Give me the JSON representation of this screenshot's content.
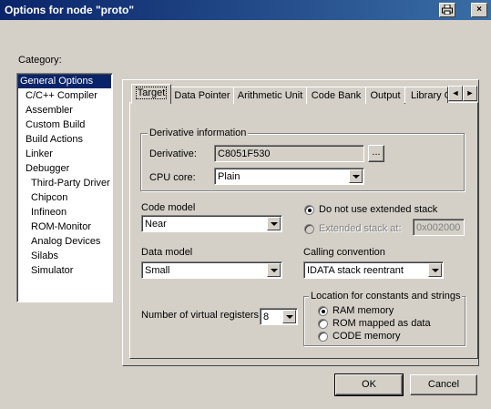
{
  "window": {
    "title": "Options for node \"proto\"",
    "print_icon": "printer-icon",
    "close_label": "×"
  },
  "category": {
    "label": "Category:",
    "items": [
      {
        "label": "General Options"
      },
      {
        "label": "C/C++ Compiler"
      },
      {
        "label": "Assembler"
      },
      {
        "label": "Custom Build"
      },
      {
        "label": "Build Actions"
      },
      {
        "label": "Linker"
      },
      {
        "label": "Debugger"
      },
      {
        "label": "Third-Party Driver"
      },
      {
        "label": "Chipcon"
      },
      {
        "label": "Infineon"
      },
      {
        "label": "ROM-Monitor"
      },
      {
        "label": "Analog Devices"
      },
      {
        "label": "Silabs"
      },
      {
        "label": "Simulator"
      }
    ],
    "selected": "General Options"
  },
  "tabs": [
    {
      "label": "Target"
    },
    {
      "label": "Data Pointer"
    },
    {
      "label": "Arithmetic Unit"
    },
    {
      "label": "Code Bank"
    },
    {
      "label": "Output"
    },
    {
      "label": "Library C"
    }
  ],
  "tab_scroll": {
    "left": "◄",
    "right": "►"
  },
  "derivative": {
    "group_label": "Derivative information",
    "derivative_label": "Derivative:",
    "derivative_value": "C8051F530",
    "browse_label": "...",
    "cpu_core_label": "CPU core:",
    "cpu_core_value": "Plain"
  },
  "code_model": {
    "label": "Code model",
    "value": "Near"
  },
  "data_model": {
    "label": "Data model",
    "value": "Small"
  },
  "stack": {
    "no_extended_label": "Do not use extended stack",
    "extended_label": "Extended stack at:",
    "extended_value": "0x002000",
    "selected": "no_extended"
  },
  "calling_convention": {
    "label": "Calling convention",
    "value": "IDATA stack reentrant"
  },
  "virtual_registers": {
    "label": "Number of virtual registers:",
    "value": "8"
  },
  "location": {
    "group_label": "Location for constants and strings",
    "options": [
      {
        "label": "RAM memory",
        "selected": true
      },
      {
        "label": "ROM mapped as data",
        "selected": false
      },
      {
        "label": "CODE memory",
        "selected": false
      }
    ]
  },
  "buttons": {
    "ok": "OK",
    "cancel": "Cancel"
  }
}
